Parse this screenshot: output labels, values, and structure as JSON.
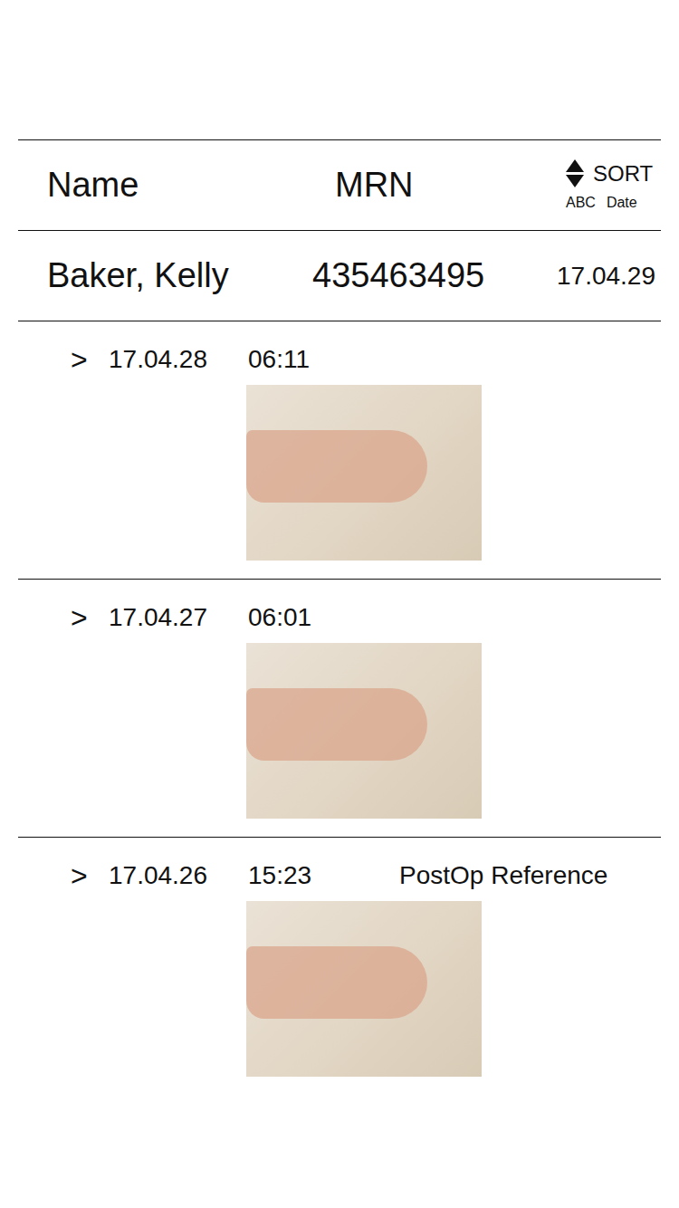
{
  "header": {
    "name_label": "Name",
    "mrn_label": "MRN",
    "sort": {
      "label": "SORT",
      "options": [
        "ABC",
        "Date"
      ]
    }
  },
  "patient": {
    "name": "Baker, Kelly",
    "mrn": "435463495",
    "date": "17.04.29"
  },
  "entries": [
    {
      "chevron": ">",
      "date": "17.04.28",
      "time": "06:11",
      "label": ""
    },
    {
      "chevron": ">",
      "date": "17.04.27",
      "time": "06:01",
      "label": ""
    },
    {
      "chevron": ">",
      "date": "17.04.26",
      "time": "15:23",
      "label": "PostOp Reference"
    }
  ]
}
